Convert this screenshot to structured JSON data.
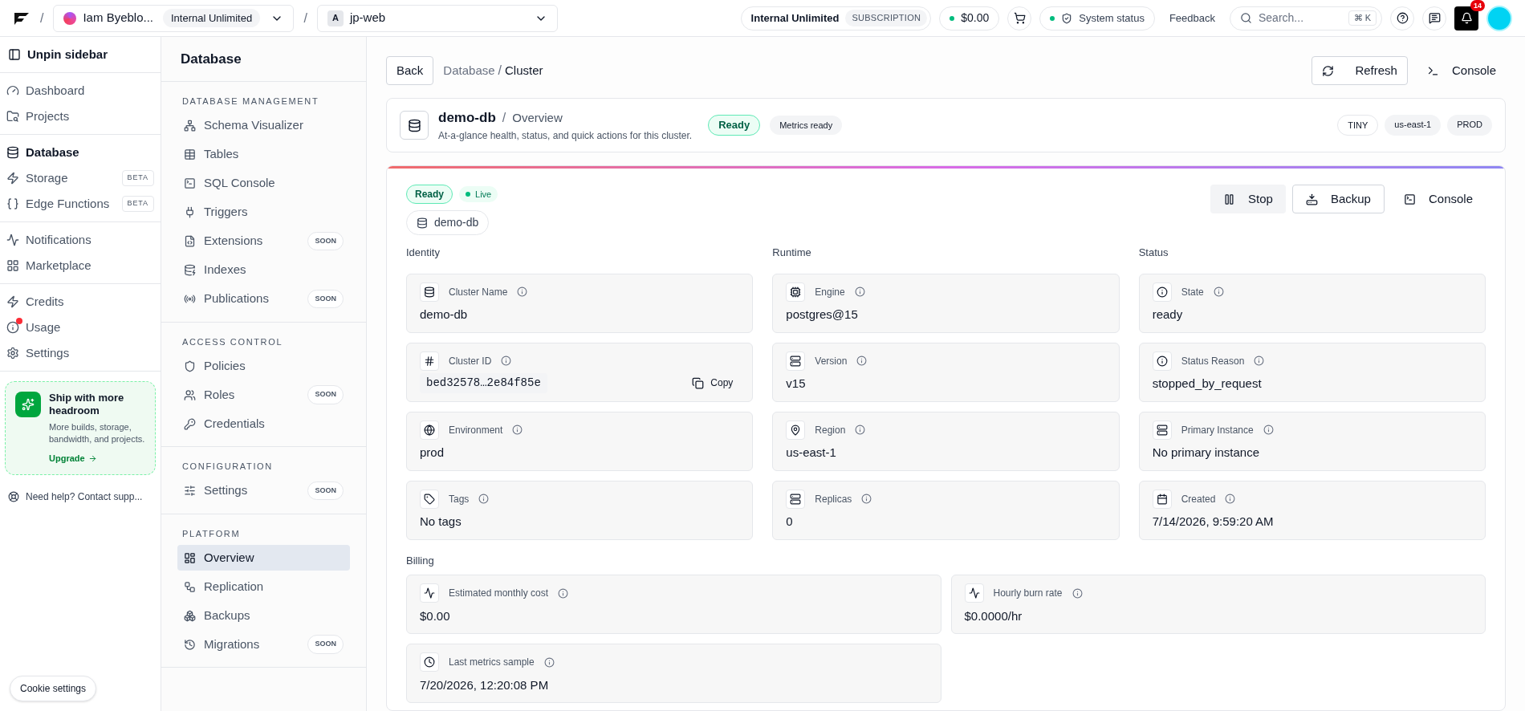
{
  "topbar": {
    "separators": [
      "/",
      "/"
    ],
    "org": {
      "name": "Iam Byeblo...",
      "plan": "Internal Unlimited"
    },
    "project": {
      "initial": "A",
      "name": "jp-web"
    },
    "subscription": {
      "plan": "Internal Unlimited",
      "label": "SUBSCRIPTION"
    },
    "balance": "$0.00",
    "system_status": "System status",
    "feedback": "Feedback",
    "search": {
      "placeholder": "Search...",
      "shortcut": "⌘ K"
    },
    "notifications": "14"
  },
  "sidebar": {
    "unpin": "Unpin sidebar",
    "groups": [
      [
        {
          "label": "Dashboard",
          "selected": false
        },
        {
          "label": "Projects",
          "selected": false
        }
      ],
      [
        {
          "label": "Database",
          "selected": true
        },
        {
          "label": "Storage",
          "selected": false,
          "badge": "BETA"
        },
        {
          "label": "Edge Functions",
          "selected": false,
          "badge": "BETA"
        }
      ],
      [
        {
          "label": "Notifications",
          "selected": false
        },
        {
          "label": "Marketplace",
          "selected": false
        }
      ],
      [
        {
          "label": "Credits",
          "selected": false
        },
        {
          "label": "Usage",
          "selected": false,
          "alert": true
        },
        {
          "label": "Settings",
          "selected": false
        }
      ]
    ],
    "promo": {
      "title": "Ship with more headroom",
      "text": "More builds, storage, bandwidth, and projects.",
      "link": "Upgrade"
    },
    "help": "Need help? Contact supp...",
    "cookie": "Cookie settings"
  },
  "subnav": {
    "title": "Database",
    "sections": [
      {
        "heading": "DATABASE MANAGEMENT",
        "items": [
          {
            "label": "Schema Visualizer",
            "selected": false
          },
          {
            "label": "Tables",
            "selected": false
          },
          {
            "label": "SQL Console",
            "selected": false
          },
          {
            "label": "Triggers",
            "selected": false
          },
          {
            "label": "Extensions",
            "selected": false,
            "badge": "SOON"
          },
          {
            "label": "Indexes",
            "selected": false
          },
          {
            "label": "Publications",
            "selected": false,
            "badge": "SOON"
          }
        ]
      },
      {
        "heading": "ACCESS CONTROL",
        "items": [
          {
            "label": "Policies",
            "selected": false
          },
          {
            "label": "Roles",
            "selected": false,
            "badge": "SOON"
          },
          {
            "label": "Credentials",
            "selected": false
          }
        ]
      },
      {
        "heading": "CONFIGURATION",
        "items": [
          {
            "label": "Settings",
            "selected": false,
            "badge": "SOON"
          }
        ]
      },
      {
        "heading": "PLATFORM",
        "items": [
          {
            "label": "Overview",
            "selected": true
          },
          {
            "label": "Replication",
            "selected": false
          },
          {
            "label": "Backups",
            "selected": false
          },
          {
            "label": "Migrations",
            "selected": false,
            "badge": "SOON"
          }
        ]
      }
    ]
  },
  "main": {
    "back": "Back",
    "breadcrumb": [
      "Database",
      "Cluster"
    ],
    "breadcrumb_separator": "/",
    "refresh": "Refresh",
    "console": "Console",
    "header": {
      "name": "demo-db",
      "separator": "/",
      "section": "Overview",
      "description": "At-a-glance health, status, and quick actions for this cluster.",
      "status": "Ready",
      "metrics": "Metrics ready",
      "tags": [
        "TINY",
        "us-east-1",
        "PROD"
      ]
    },
    "cluster": {
      "status": "Ready",
      "live": "Live",
      "name": "demo-db",
      "actions": [
        {
          "label": "Stop",
          "kind": "muted"
        },
        {
          "label": "Backup",
          "kind": "outline"
        },
        {
          "label": "Console",
          "kind": "ghost"
        }
      ],
      "columns": [
        {
          "title": "Identity",
          "fields": [
            {
              "label": "Cluster Name",
              "value": "demo-db"
            },
            {
              "label": "Cluster ID",
              "value": "bed32578…2e84f85e",
              "kind": "mono",
              "copy": "Copy"
            },
            {
              "label": "Environment",
              "value": "prod"
            },
            {
              "label": "Tags",
              "value": "No tags"
            }
          ]
        },
        {
          "title": "Runtime",
          "fields": [
            {
              "label": "Engine",
              "value": "postgres@15"
            },
            {
              "label": "Version",
              "value": "v15"
            },
            {
              "label": "Region",
              "value": "us-east-1"
            },
            {
              "label": "Replicas",
              "value": "0"
            }
          ]
        },
        {
          "title": "Status",
          "fields": [
            {
              "label": "State",
              "value": "ready"
            },
            {
              "label": "Status Reason",
              "value": "stopped_by_request"
            },
            {
              "label": "Primary Instance",
              "value": "No primary instance"
            },
            {
              "label": "Created",
              "value": "7/14/2026, 9:59:20 AM"
            }
          ]
        }
      ],
      "billing": {
        "title": "Billing",
        "fields": [
          {
            "label": "Estimated monthly cost",
            "value": "$0.00"
          },
          {
            "label": "Hourly burn rate",
            "value": "$0.0000/hr"
          },
          {
            "label": "Last metrics sample",
            "value": "7/20/2026, 12:20:08 PM"
          }
        ]
      }
    }
  }
}
